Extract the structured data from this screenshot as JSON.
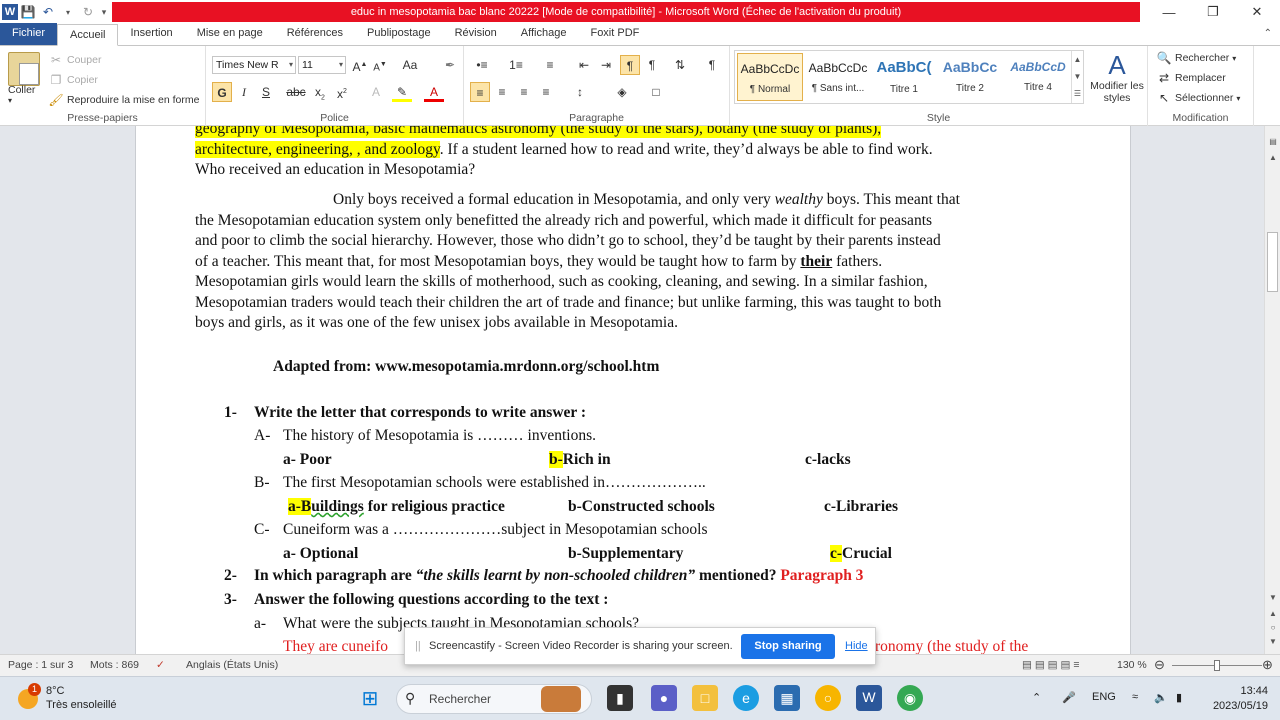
{
  "window": {
    "title": "educ in mesopotamia bac blanc 20222 [Mode de compatibilité] - Microsoft Word (Échec de l'activation du produit)",
    "minimize_icon": "minimize-icon",
    "maximize_icon": "restore-icon",
    "close_icon": "close-icon"
  },
  "tabs": [
    "Fichier",
    "Accueil",
    "Insertion",
    "Mise en page",
    "Références",
    "Publipostage",
    "Révision",
    "Affichage",
    "Foxit PDF"
  ],
  "active_tab": "Accueil",
  "ribbon": {
    "clipboard": {
      "paste": "Coller",
      "cut": "Couper",
      "copy": "Copier",
      "format_painter": "Reproduire la mise en forme",
      "group": "Presse-papiers"
    },
    "font": {
      "family": "Times New R",
      "size": "11",
      "group": "Police"
    },
    "paragraph": {
      "group": "Paragraphe"
    },
    "styles": {
      "items": [
        {
          "preview": "AaBbCcDc",
          "name": "¶ Normal"
        },
        {
          "preview": "AaBbCcDc",
          "name": "¶ Sans int..."
        },
        {
          "preview": "AaBbC(",
          "name": "Titre 1"
        },
        {
          "preview": "AaBbCc",
          "name": "Titre 2"
        },
        {
          "preview": "AaBbCcD",
          "name": "Titre 4"
        }
      ],
      "change": "Modifier les styles",
      "group": "Style"
    },
    "editing": {
      "find": "Rechercher",
      "replace": "Remplacer",
      "select": "Sélectionner",
      "group": "Modification"
    }
  },
  "document": {
    "line0": "geography of Mesopotamia, basic mathematics  astronomy (the study of the stars), botany (the study of plants),",
    "line1_hl": "architecture,  engineering,  , and zoology",
    "line1_rest": ". If a student learned how to read and write, they’d always be able to find work.",
    "line2": "Who received an education in Mesopotamia?",
    "p2": [
      "Only boys received  a formal education in Mesopotamia, and only very ",
      "wealthy",
      " boys. This meant that",
      "the Mesopotamian education system  only benefitted the already rich and powerful, which made it difficult  for peasants",
      "and poor to climb the social hierarchy.  However, those who didn’t go to school, they’d be taught by their parents instead",
      "of a teacher.  This meant that, for most Mesopotamian boys, they would be taught how to farm by ",
      "their",
      " fathers.",
      "Mesopotamian girls would learn the skills of motherhood, such as cooking, cleaning, and sewing.  In a similar  fashion,",
      "Mesopotamian traders would teach their children the art of trade and finance; but unlike farming, this was taught to both",
      "boys and girls,  as it was one of the few unisex jobs available  in Mesopotamia."
    ],
    "source": "Adapted from: www.mesopotamia.mrdonn.org/school.htm",
    "q1_num": "1-",
    "q1": "Write the letter that corresponds to write answer :",
    "qA_num": "A-",
    "qA": "The history of Mesopotamia is ……… inventions.",
    "qA_a": "a-   Poor",
    "qA_b_hl": "b-",
    "qA_b": "Rich in",
    "qA_c": "c-lacks",
    "qB_num": "B-",
    "qB": "The first Mesopotamian schools were established  in………………..",
    "qB_a_hl": "a-B",
    "qB_a_u": "uildings",
    "qB_a_rest": " for religious  practice",
    "qB_b": "b-Constructed  schools",
    "qB_c": "c-Libraries",
    "qC_num": "C-",
    "qC": "Cuneiform was a …………………subject  in Mesopotamian schools",
    "qC_a": "a-   Optional",
    "qC_b": "b-Supplementary",
    "qC_c_hl": "c-",
    "qC_c": "Crucial",
    "q2_num": "2-",
    "q2_a": "In which paragraph are ",
    "q2_quote": "“the skills learnt by non-schooled children”",
    "q2_b": " mentioned? ",
    "q2_ans": "Paragraph 3",
    "q3_num": "3-",
    "q3": "Answer the following questions according to the text :",
    "q3a_num": "a-",
    "q3a": "What were the subjects taught in Mesopotamian schools?",
    "ans_left": "They are cuneifo",
    "ans_right": "ronomy (the study of the"
  },
  "toast": {
    "message": "Screencastify - Screen Video Recorder is sharing your screen.",
    "stop": "Stop sharing",
    "hide": "Hide"
  },
  "statusbar": {
    "page": "Page : 1 sur 3",
    "words": "Mots : 869",
    "language": "Anglais (États Unis)",
    "zoom": "130 %"
  },
  "taskbar": {
    "weather_temp": "8°C",
    "weather_desc": "Très ensoleillé",
    "weather_badge": "1",
    "search": "Rechercher",
    "lang": "ENG",
    "time": "13:44",
    "date": "2023/05/19"
  },
  "colors": {
    "title_bar_error": "#e81123",
    "file_tab": "#2b579a",
    "highlight": "#ffff00",
    "answer_red": "#e02020",
    "stop_button": "#1a73e8"
  }
}
